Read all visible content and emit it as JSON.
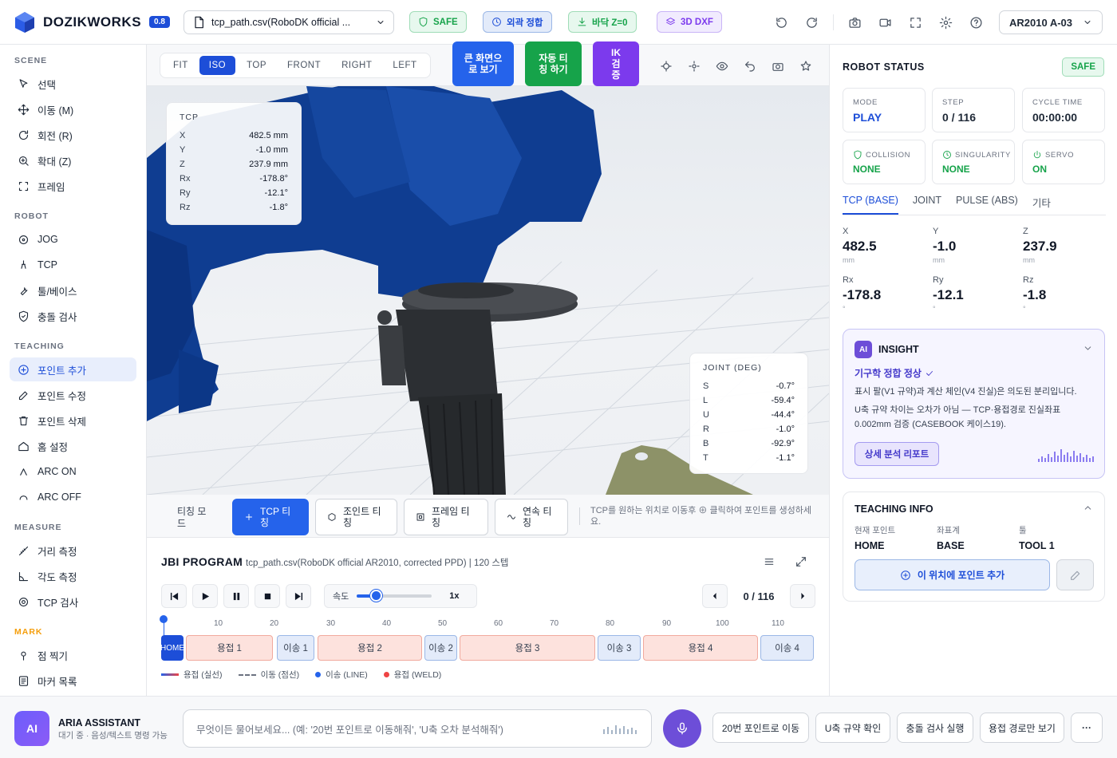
{
  "app": {
    "name": "DOZIKWORKS",
    "version": "0.8"
  },
  "topbar": {
    "file": "tcp_path.csv(RoboDK official ...",
    "chips": {
      "safe": "SAFE",
      "ext": "외곽 정합",
      "floor": "바닥 Z=0",
      "dxf": "3D DXF"
    },
    "robot": "AR2010 A-03",
    "colors": {
      "brand": "#1d4ed8",
      "safe": "#16a34a",
      "purple": "#7c3aed"
    }
  },
  "sidebar": {
    "scene": {
      "title": "SCENE",
      "items": [
        "선택",
        "이동 (M)",
        "회전 (R)",
        "확대 (Z)",
        "프레임"
      ]
    },
    "robot": {
      "title": "ROBOT",
      "items": [
        "JOG",
        "TCP",
        "툴/베이스",
        "충돌 검사"
      ]
    },
    "teaching": {
      "title": "TEACHING",
      "items": [
        "포인트 추가",
        "포인트 수정",
        "포인트 삭제",
        "홈 설정",
        "ARC ON",
        "ARC OFF"
      ]
    },
    "measure": {
      "title": "MEASURE",
      "items": [
        "거리 측정",
        "각도 측정",
        "TCP 검사"
      ]
    },
    "mark": {
      "title": "MARK",
      "items": [
        "점 찍기",
        "마커 목록"
      ]
    }
  },
  "view": {
    "tabs": [
      "FIT",
      "ISO",
      "TOP",
      "FRONT",
      "RIGHT",
      "LEFT"
    ],
    "active": "ISO",
    "big": {
      "full": "큰 화면으로 보기",
      "auto": "자동 티칭 하기",
      "ik": "IK 검증"
    }
  },
  "tcp": {
    "title": "TCP",
    "rows": [
      {
        "k": "X",
        "v": "482.5 mm"
      },
      {
        "k": "Y",
        "v": "-1.0 mm"
      },
      {
        "k": "Z",
        "v": "237.9 mm"
      },
      {
        "k": "Rx",
        "v": "-178.8°"
      },
      {
        "k": "Ry",
        "v": "-12.1°"
      },
      {
        "k": "Rz",
        "v": "-1.8°"
      }
    ]
  },
  "joint": {
    "title": "JOINT (DEG)",
    "rows": [
      {
        "k": "S",
        "v": "-0.7°"
      },
      {
        "k": "L",
        "v": "-59.4°"
      },
      {
        "k": "U",
        "v": "-44.4°"
      },
      {
        "k": "R",
        "v": "-1.0°"
      },
      {
        "k": "B",
        "v": "-92.9°"
      },
      {
        "k": "T",
        "v": "-1.1°"
      }
    ]
  },
  "mode": {
    "label": "티칭 모드",
    "buttons": [
      "TCP 티칭",
      "조인트 티칭",
      "프레임 티칭",
      "연속 티칭"
    ],
    "hint": "TCP를 원하는 위치로 이동후 ⊕ 클릭하여 포인트를 생성하세요."
  },
  "program": {
    "title": "JBI PROGRAM",
    "subtitle": "tcp_path.csv(RoboDK official AR2010, corrected PPD) | 120 스텝",
    "speed_label": "속도",
    "speed_value": "1x",
    "speed_level": 0.25,
    "step": "0 / 116",
    "ticks": [
      "10",
      "20",
      "30",
      "40",
      "50",
      "60",
      "70",
      "80",
      "90",
      "100",
      "110"
    ],
    "segments": [
      "HOME",
      "용접 1",
      "이송 1",
      "용접 2",
      "이송 2",
      "용접 3",
      "이송 3",
      "용접 4",
      "이송 4"
    ],
    "legend": [
      "용접 (실선)",
      "이동 (점선)",
      "이송 (LINE)",
      "용접 (WELD)"
    ]
  },
  "status": {
    "title": "ROBOT STATUS",
    "safe": "SAFE",
    "mode": {
      "label": "MODE",
      "value": "PLAY"
    },
    "step": {
      "label": "STEP",
      "value": "0 / 116"
    },
    "cycle": {
      "label": "CYCLE TIME",
      "value": "00:00:00"
    },
    "collision": {
      "label": "COLLISION",
      "value": "NONE"
    },
    "singularity": {
      "label": "SINGULARITY",
      "value": "NONE"
    },
    "servo": {
      "label": "SERVO",
      "value": "ON"
    },
    "tabs": [
      "TCP (BASE)",
      "JOINT",
      "PULSE (ABS)",
      "기타"
    ],
    "coords": [
      {
        "k": "X",
        "v": "482.5",
        "u": "mm"
      },
      {
        "k": "Y",
        "v": "-1.0",
        "u": "mm"
      },
      {
        "k": "Z",
        "v": "237.9",
        "u": "mm"
      },
      {
        "k": "Rx",
        "v": "-178.8",
        "u": "°"
      },
      {
        "k": "Ry",
        "v": "-12.1",
        "u": "°"
      },
      {
        "k": "Rz",
        "v": "-1.8",
        "u": "°"
      }
    ]
  },
  "insight": {
    "badge": "AI",
    "title": "INSIGHT",
    "headline": "기구학 정합 정상",
    "p1": "표시 팔(V1 규약)과 계산 체인(V4 진실)은 의도된 분리입니다.",
    "p2": "U축 규약 차이는 오차가 아님 — TCP·용접경로 진실좌표 0.002mm 검증 (CASEBOOK 케이스19).",
    "button": "상세 분석 리포트"
  },
  "teaching_info": {
    "title": "TEACHING INFO",
    "cols": [
      {
        "k": "현재 포인트",
        "v": "HOME"
      },
      {
        "k": "좌표계",
        "v": "BASE"
      },
      {
        "k": "툴",
        "v": "TOOL 1"
      }
    ],
    "add": "이 위치에 포인트 추가"
  },
  "assistant": {
    "avatar": "AI",
    "name": "ARIA ASSISTANT",
    "status": "대기 중 · 음성/텍스트 명령 가능",
    "placeholder": "무엇이든 물어보세요... (예: '20번 포인트로 이동해줘', 'U축 오차 분석해줘')",
    "quick": [
      "20번 포인트로 이동",
      "U축 규약 확인",
      "충돌 검사 실행",
      "용접 경로만 보기"
    ],
    "more": "···"
  }
}
